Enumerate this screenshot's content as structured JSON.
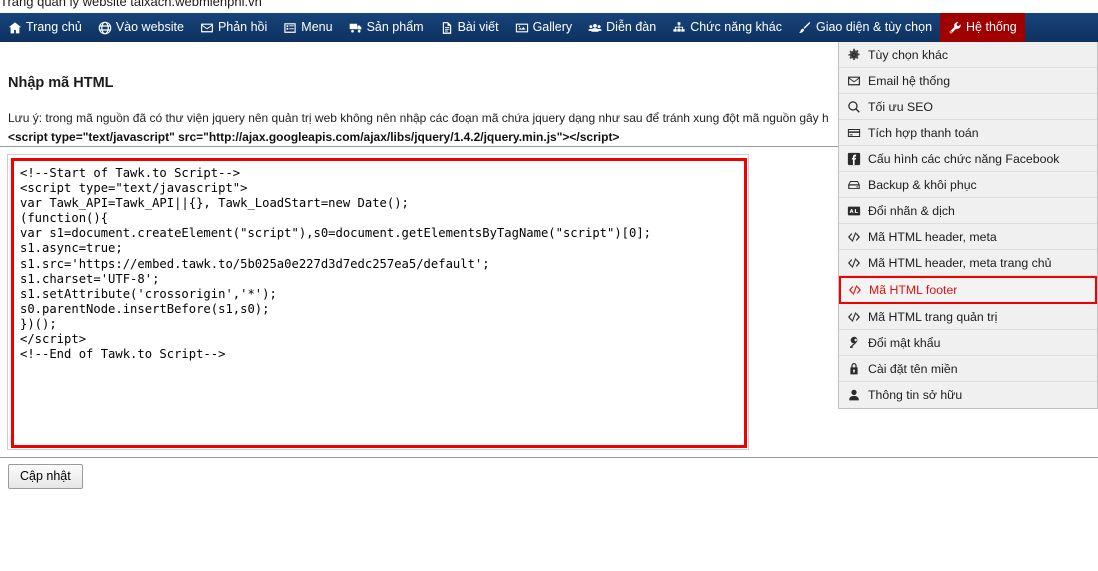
{
  "browser": {
    "page_title": "Trang quản lý website taixach.webmienphi.vn"
  },
  "navbar": {
    "items": [
      {
        "label": "Trang chủ",
        "icon": "home-icon",
        "active": false
      },
      {
        "label": "Vào website",
        "icon": "globe-icon",
        "active": false
      },
      {
        "label": "Phản hồi",
        "icon": "envelope-icon",
        "active": false
      },
      {
        "label": "Menu",
        "icon": "list-icon",
        "active": false
      },
      {
        "label": "Sản phẩm",
        "icon": "truck-icon",
        "active": false
      },
      {
        "label": "Bài viết",
        "icon": "document-icon",
        "active": false
      },
      {
        "label": "Gallery",
        "icon": "image-icon",
        "active": false
      },
      {
        "label": "Diễn đàn",
        "icon": "users-icon",
        "active": false
      },
      {
        "label": "Chức năng khác",
        "icon": "sitemap-icon",
        "active": false
      },
      {
        "label": "Giao diện & tùy chọn",
        "icon": "brush-icon",
        "active": false
      },
      {
        "label": "Hệ thống",
        "icon": "wrench-icon",
        "active": true
      }
    ],
    "active_background": "#a00000",
    "background": "#123a6b"
  },
  "main": {
    "heading": "Nhập mã HTML",
    "note_line1": "Lưu ý: trong mã nguồn đã có thư viện jquery nên quản trị web không nên nhập các đoạn mã chứa jquery dạng như sau để tránh xung đột mã nguồn gây h",
    "note_line2": "<script type=\"text/javascript\" src=\"http://ajax.googleapis.com/ajax/libs/jquery/1.4.2/jquery.min.js\"></script>",
    "code_value": "<!--Start of Tawk.to Script-->\n<script type=\"text/javascript\">\nvar Tawk_API=Tawk_API||{}, Tawk_LoadStart=new Date();\n(function(){\nvar s1=document.createElement(\"script\"),s0=document.getElementsByTagName(\"script\")[0];\ns1.async=true;\ns1.src='https://embed.tawk.to/5b025a0e227d3d7edc257ea5/default';\ns1.charset='UTF-8';\ns1.setAttribute('crossorigin','*');\ns0.parentNode.insertBefore(s1,s0);\n})();\n</script>\n<!--End of Tawk.to Script-->",
    "code_border_color": "#f10000",
    "update_button_label": "Cập nhật"
  },
  "dropdown": {
    "items": [
      {
        "label": "Tùy chọn khác",
        "icon": "gear-icon",
        "highlight": false
      },
      {
        "label": "Email hệ thống",
        "icon": "envelope-icon",
        "highlight": false
      },
      {
        "label": "Tối ưu SEO",
        "icon": "search-icon",
        "highlight": false
      },
      {
        "label": "Tích hợp thanh toán",
        "icon": "credit-card-icon",
        "highlight": false
      },
      {
        "label": "Cấu hình các chức năng Facebook",
        "icon": "facebook-icon",
        "highlight": false
      },
      {
        "label": "Backup & khôi phục",
        "icon": "harddrive-icon",
        "highlight": false
      },
      {
        "label": "Đổi nhãn & dịch",
        "icon": "translate-icon",
        "highlight": false
      },
      {
        "label": "Mã HTML header, meta",
        "icon": "code-icon",
        "highlight": false
      },
      {
        "label": "Mã HTML header, meta trang chủ",
        "icon": "code-icon",
        "highlight": false
      },
      {
        "label": "Mã HTML footer",
        "icon": "code-icon",
        "highlight": true
      },
      {
        "label": "Mã HTML trang quản trị",
        "icon": "code-icon",
        "highlight": false
      },
      {
        "label": "Đổi mật khẩu",
        "icon": "key-icon",
        "highlight": false
      },
      {
        "label": "Cài đặt tên miền",
        "icon": "lock-icon",
        "highlight": false
      },
      {
        "label": "Thông tin sở hữu",
        "icon": "user-icon",
        "highlight": false
      }
    ],
    "highlight_color": "#e31010"
  }
}
